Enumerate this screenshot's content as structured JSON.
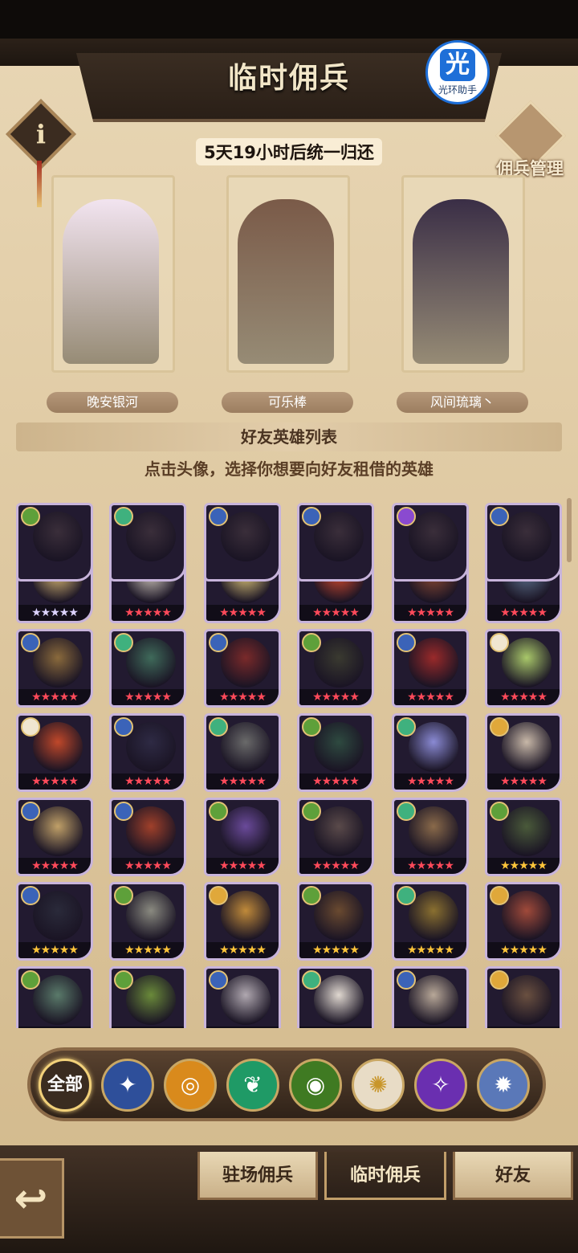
{
  "header": {
    "title": "临时佣兵",
    "badge_label": "光环助手",
    "badge_glyph": "光",
    "info_glyph": "i",
    "manage_label": "佣兵管理"
  },
  "timer_text": "5天19小时后统一归还",
  "mercenaries": [
    {
      "owner": "晚安银河",
      "color": "#f2e4f0"
    },
    {
      "owner": "可乐棒",
      "color": "#7a5a48"
    },
    {
      "owner": "风间琉璃丶",
      "color": "#3a2e46"
    }
  ],
  "section_title": "好友英雄列表",
  "instruction": "点击头像，选择你想要向好友租借的英雄",
  "heroes": [
    {
      "portrait": "golden-haired-mage",
      "faction": "lightbearer",
      "stars": "★★★★★",
      "star_color": "#dcd3ff",
      "tint": "#d9b974"
    },
    {
      "portrait": "white-bearded-sage",
      "faction": "lightbearer",
      "stars": "★★★★★",
      "star_color": "#ff4a5a",
      "tint": "#cfc6bc"
    },
    {
      "portrait": "blonde-braided-knight",
      "faction": "lightbearer",
      "stars": "★★★★★",
      "star_color": "#ff4a5a",
      "tint": "#e1c97a"
    },
    {
      "portrait": "red-winged-fairy",
      "faction": "mauler",
      "stars": "★★★★★",
      "star_color": "#ff4a5a",
      "tint": "#d44a2e"
    },
    {
      "portrait": "red-beard-dwarf",
      "faction": "lightbearer",
      "stars": "★★★★★",
      "star_color": "#ff4a5a",
      "tint": "#8c4a34"
    },
    {
      "portrait": "blue-haired-undead",
      "faction": "graveborn",
      "stars": "★★★★★",
      "star_color": "#ff4a5a",
      "tint": "#5b6f8a"
    },
    {
      "portrait": "crowned-warrior",
      "faction": "lightbearer",
      "stars": "★★★★★",
      "star_color": "#ff4a5a",
      "tint": "#8a6a3c"
    },
    {
      "portrait": "red-hat-witch",
      "faction": "wilder",
      "stars": "★★★★★",
      "star_color": "#ff4a5a",
      "tint": "#3f6a5a"
    },
    {
      "portrait": "horned-demon-girl",
      "faction": "lightbearer",
      "stars": "★★★★★",
      "star_color": "#ff4a5a",
      "tint": "#7a2a2a"
    },
    {
      "portrait": "tall-hooded-figure",
      "faction": "graveborn",
      "stars": "★★★★★",
      "star_color": "#ff4a5a",
      "tint": "#3a3a30"
    },
    {
      "portrait": "masked-red-hood",
      "faction": "lightbearer",
      "stars": "★★★★★",
      "star_color": "#ff4a5a",
      "tint": "#9a2a2a"
    },
    {
      "portrait": "green-haired-elf",
      "faction": "celestial",
      "stars": "★★★★★",
      "star_color": "#ff4a5a",
      "tint": "#a9c86a"
    },
    {
      "portrait": "monkey-king",
      "faction": "celestial",
      "stars": "★★★★★",
      "star_color": "#ff4a5a",
      "tint": "#c0482a"
    },
    {
      "portrait": "horned-dark-lady",
      "faction": "lightbearer",
      "stars": "★★★★★",
      "star_color": "#ff4a5a",
      "tint": "#2e2a44"
    },
    {
      "portrait": "raccoon-ranger",
      "faction": "wilder",
      "stars": "★★★★★",
      "star_color": "#ff4a5a",
      "tint": "#6a6a6a"
    },
    {
      "portrait": "green-skull-dragon",
      "faction": "graveborn",
      "stars": "★★★★★",
      "star_color": "#ff4a5a",
      "tint": "#2e4a40"
    },
    {
      "portrait": "ice-spirit-beast",
      "faction": "wilder",
      "stars": "★★★★★",
      "star_color": "#ff4a5a",
      "tint": "#8a8ad4"
    },
    {
      "portrait": "white-haired-oracle",
      "faction": "mauler",
      "stars": "★★★★★",
      "star_color": "#ff4a5a",
      "tint": "#c8b8a8"
    },
    {
      "portrait": "armored-blonde-knight",
      "faction": "lightbearer",
      "stars": "★★★★★",
      "star_color": "#ff4a5a",
      "tint": "#c0a068"
    },
    {
      "portrait": "red-ogre-chief",
      "faction": "lightbearer",
      "stars": "★★★★★",
      "star_color": "#ff4a5a",
      "tint": "#a0402a"
    },
    {
      "portrait": "purple-haired-ghost",
      "faction": "graveborn",
      "stars": "★★★★★",
      "star_color": "#ff4a5a",
      "tint": "#6a4a9a"
    },
    {
      "portrait": "pale-vampire",
      "faction": "graveborn",
      "stars": "★★★★★",
      "star_color": "#ff4a5a",
      "tint": "#5a4a4a"
    },
    {
      "portrait": "elven-archer-lord",
      "faction": "wilder",
      "stars": "★★★★★",
      "star_color": "#ff4a5a",
      "tint": "#8a6a4a"
    },
    {
      "portrait": "green-eyed-lich",
      "faction": "graveborn",
      "stars": "★★★★★",
      "star_color": "#ffc53a",
      "tint": "#4a5a3a"
    },
    {
      "portrait": "masked-thief",
      "faction": "lightbearer",
      "stars": "★★★★★",
      "star_color": "#ffc53a",
      "tint": "#2a2a3a"
    },
    {
      "portrait": "bone-king",
      "faction": "graveborn",
      "stars": "★★★★★",
      "star_color": "#ffc53a",
      "tint": "#8a8a80"
    },
    {
      "portrait": "lion-warrior",
      "faction": "mauler",
      "stars": "★★★★★",
      "star_color": "#ffc53a",
      "tint": "#c08a3a"
    },
    {
      "portrait": "bearded-gunslinger",
      "faction": "graveborn",
      "stars": "★★★★★",
      "star_color": "#ffc53a",
      "tint": "#6a4a30"
    },
    {
      "portrait": "gold-helmed-champion",
      "faction": "wilder",
      "stars": "★★★★★",
      "star_color": "#ffc53a",
      "tint": "#8a7030"
    },
    {
      "portrait": "wild-beast-rider",
      "faction": "mauler",
      "stars": "★★★★★",
      "star_color": "#ffc53a",
      "tint": "#a04a3a"
    },
    {
      "portrait": "goblin-brute",
      "faction": "graveborn",
      "stars": "★★★★★",
      "star_color": "#ffc53a",
      "tint": "#5a7a6a"
    },
    {
      "portrait": "green-golem",
      "faction": "graveborn",
      "stars": "★★★★★",
      "star_color": "#ffc53a",
      "tint": "#6a8a3a"
    },
    {
      "portrait": "silver-haired-assassin",
      "faction": "lightbearer",
      "stars": "★★★★★",
      "star_color": "#ffc53a",
      "tint": "#b0a8b0"
    },
    {
      "portrait": "white-sheep-girl",
      "faction": "wilder",
      "stars": "★★★★★",
      "star_color": "#ffc53a",
      "tint": "#e0d8d0"
    },
    {
      "portrait": "old-scholar",
      "faction": "lightbearer",
      "stars": "★★★★★",
      "star_color": "#ffc53a",
      "tint": "#b8a898"
    },
    {
      "portrait": "brown-haired-gunner",
      "faction": "mauler",
      "stars": "★★★★★",
      "star_color": "#ffc53a",
      "tint": "#6a5040"
    },
    {
      "portrait": "partial-row",
      "faction": "graveborn",
      "stars": "",
      "star_color": "#ffc53a",
      "tint": "#3a2e3a"
    },
    {
      "portrait": "partial-row",
      "faction": "wilder",
      "stars": "",
      "star_color": "#ffc53a",
      "tint": "#3a2e3a"
    },
    {
      "portrait": "partial-row",
      "faction": "lightbearer",
      "stars": "",
      "star_color": "#ffc53a",
      "tint": "#3a2e3a"
    },
    {
      "portrait": "partial-row",
      "faction": "lightbearer",
      "stars": "",
      "star_color": "#ffc53a",
      "tint": "#3a2e3a"
    },
    {
      "portrait": "partial-row",
      "faction": "hypogean",
      "stars": "",
      "star_color": "#ffc53a",
      "tint": "#3a2e3a"
    },
    {
      "portrait": "partial-row",
      "faction": "lightbearer",
      "stars": "",
      "star_color": "#ffc53a",
      "tint": "#3a2e3a"
    }
  ],
  "faction_colors": {
    "lightbearer": "#3b63b8",
    "mauler": "#e0a83a",
    "wilder": "#3fb17e",
    "graveborn": "#5ea03a",
    "celestial": "#f0e6d0",
    "hypogean": "#8a4ad0",
    "dimensional": "#6a8ac8"
  },
  "filters": [
    {
      "label": "全部",
      "icon": "all-factions-icon",
      "glyph": "",
      "color": "#3a2c20"
    },
    {
      "label": "",
      "icon": "lightbearer-icon",
      "glyph": "✦",
      "color": "#2e4f9a"
    },
    {
      "label": "",
      "icon": "mauler-icon",
      "glyph": "◎",
      "color": "#d98a1c"
    },
    {
      "label": "",
      "icon": "wilder-icon",
      "glyph": "❦",
      "color": "#1f9a66"
    },
    {
      "label": "",
      "icon": "graveborn-icon",
      "glyph": "◉",
      "color": "#3f7a22"
    },
    {
      "label": "",
      "icon": "celestial-icon",
      "glyph": "✺",
      "color": "#e8dcc6"
    },
    {
      "label": "",
      "icon": "hypogean-icon",
      "glyph": "✧",
      "color": "#6a2fb0"
    },
    {
      "label": "",
      "icon": "dimensional-icon",
      "glyph": "✹",
      "color": "#5a78b8"
    }
  ],
  "tabs": [
    {
      "label": "驻场佣兵",
      "active": false
    },
    {
      "label": "临时佣兵",
      "active": true
    },
    {
      "label": "好友",
      "active": false
    }
  ],
  "back_glyph": "↩"
}
